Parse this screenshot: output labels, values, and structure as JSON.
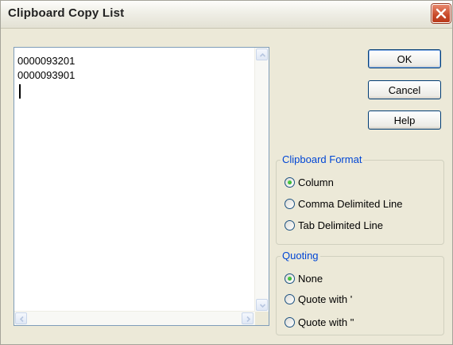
{
  "window": {
    "title": "Clipboard Copy List"
  },
  "list": {
    "lines": [
      "0000093201",
      "0000093901"
    ]
  },
  "buttons": {
    "ok": "OK",
    "cancel": "Cancel",
    "help": "Help"
  },
  "clipboard_format": {
    "legend": "Clipboard Format",
    "options": [
      "Column",
      "Comma Delimited Line",
      "Tab Delimited Line"
    ],
    "selected": "Column"
  },
  "quoting": {
    "legend": "Quoting",
    "options": [
      "None",
      "Quote with '",
      "Quote with \""
    ],
    "selected": "None"
  },
  "colors": {
    "legend_text": "#0046d5",
    "dialog_bg": "#ece9d8",
    "close_button": "#c84a2a",
    "radio_checked": "#21a121"
  },
  "icons": {
    "close": "close-icon",
    "scroll_up": "arrow-up-icon",
    "scroll_down": "arrow-down-icon",
    "scroll_left": "arrow-left-icon",
    "scroll_right": "arrow-right-icon"
  }
}
